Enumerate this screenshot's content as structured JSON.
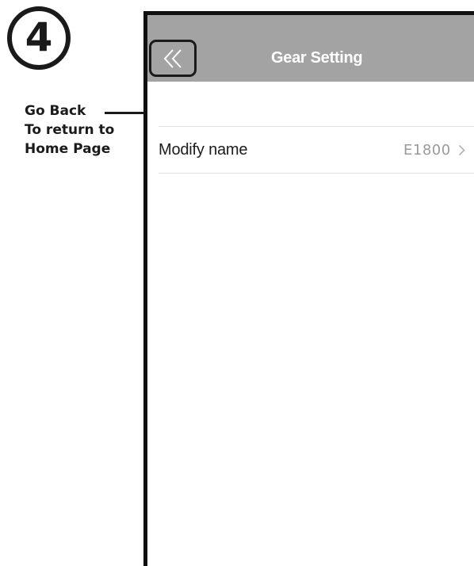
{
  "step": {
    "number": "4"
  },
  "annotation": {
    "lines": [
      "Go Back",
      "To return to",
      "Home Page"
    ]
  },
  "header": {
    "title": "Gear Setting",
    "back_icon": "double-chevron-left-icon",
    "background_color": "#a3a3a3"
  },
  "settings": {
    "items": [
      {
        "label": "Modify name",
        "value": "E1800",
        "icon": "chevron-right-icon"
      }
    ]
  }
}
